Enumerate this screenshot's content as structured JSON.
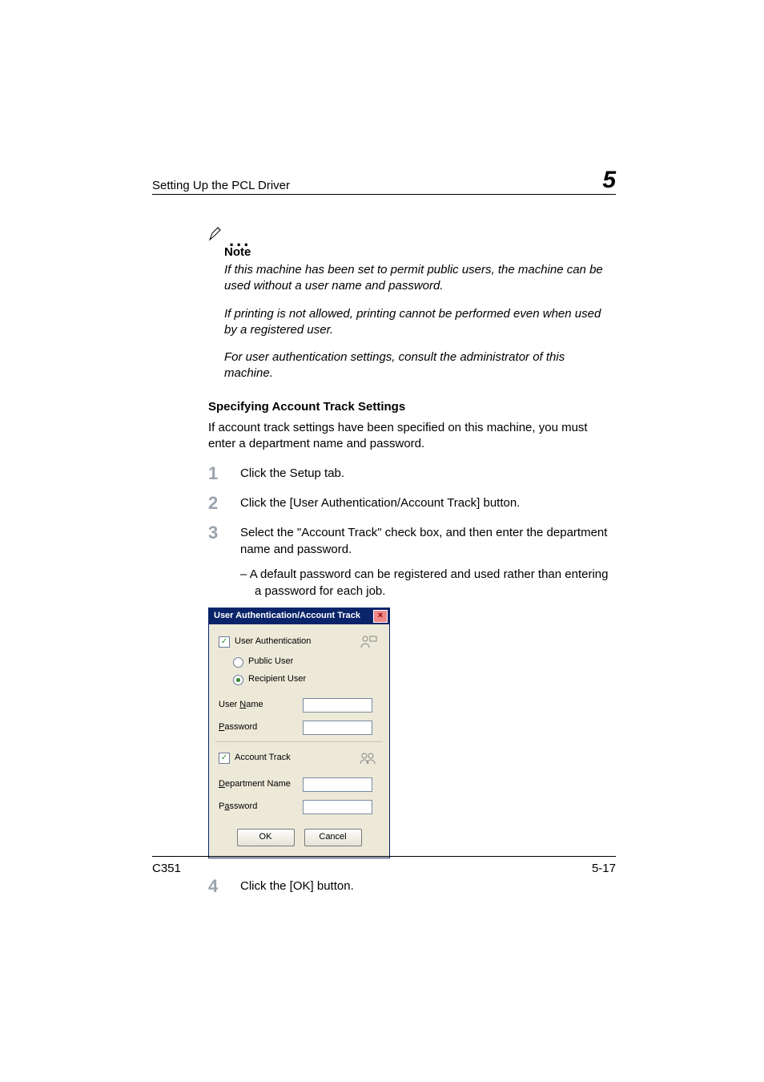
{
  "header": {
    "running_title": "Setting Up the PCL Driver",
    "chapter_number": "5"
  },
  "note": {
    "heading": "Note",
    "p1": "If this machine has been set to permit public users, the machine can be used without a user name and password.",
    "p2": "If printing is not allowed, printing cannot be performed even when used by a registered user.",
    "p3": "For user authentication settings, consult the administrator of this machine."
  },
  "section_heading": "Specifying Account Track Settings",
  "intro": "If account track settings have been specified on this machine, you must enter a department name and password.",
  "steps": {
    "s1": "Click the Setup tab.",
    "s2": "Click the [User Authentication/Account Track] button.",
    "s3": "Select the \"Account Track\" check box, and then enter the department name and password.",
    "s3sub": "A default password can be registered and used rather than entering a password for each job.",
    "s4": "Click the [OK] button."
  },
  "dialog": {
    "title": "User Authentication/Account Track",
    "user_auth_label_prefix": "User ",
    "user_auth_label_u": "A",
    "user_auth_label_suffix": "uthentication",
    "user_auth_checked": "✓",
    "public_user_u": "P",
    "public_user_suffix": "ublic User",
    "recipient_u": "R",
    "recipient_suffix": "ecipient User",
    "user_name_prefix": "User ",
    "user_name_u": "N",
    "user_name_suffix": "ame",
    "password_u": "P",
    "password_suffix": "assword",
    "account_track_prefix": "Account ",
    "account_track_u": "T",
    "account_track_suffix": "rack",
    "account_track_checked": "✓",
    "dept_u": "D",
    "dept_suffix": "epartment Name",
    "password2_prefix": "P",
    "password2_u": "a",
    "password2_suffix": "ssword",
    "ok": "OK",
    "cancel": "Cancel",
    "close_glyph": "×"
  },
  "footer": {
    "model": "C351",
    "page": "5-17"
  }
}
